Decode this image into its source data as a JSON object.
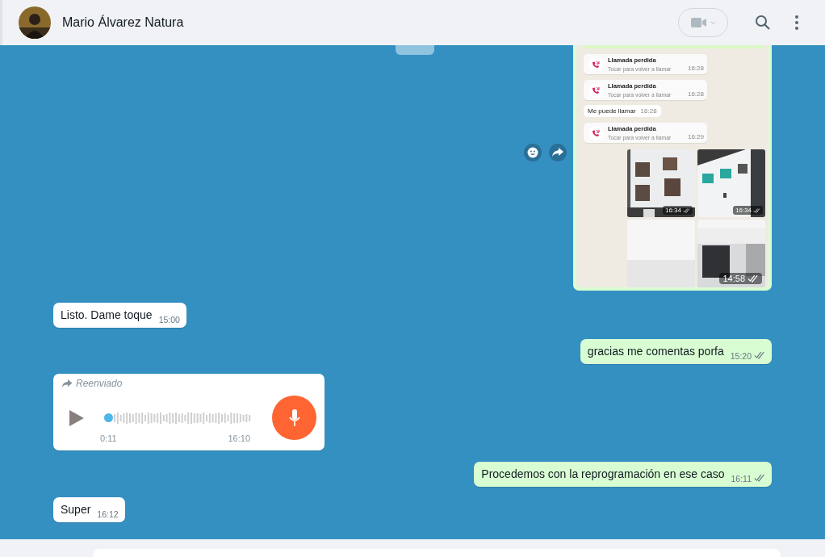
{
  "header": {
    "contact_name": "Mario Álvarez Natura"
  },
  "messages": [
    {
      "kind": "screenshot",
      "sent": true,
      "time": "14:58",
      "inner": [
        {
          "kind": "call",
          "title": "Llamada perdida",
          "subtitle": "Tocar para volver a llamar",
          "time": "16:28"
        },
        {
          "kind": "call",
          "title": "Llamada perdida",
          "subtitle": "Tocar para volver a llamar",
          "time": "16:28"
        },
        {
          "kind": "text",
          "text": "Me puede llamar",
          "time": "16:28"
        },
        {
          "kind": "call",
          "title": "Llamada perdida",
          "subtitle": "Tocar para volver a llamar",
          "time": "16:29"
        },
        {
          "kind": "photos",
          "times": [
            "16:34",
            "16:34"
          ]
        }
      ]
    },
    {
      "kind": "text",
      "sent": false,
      "text": "Listo. Dame toque",
      "time": "15:00"
    },
    {
      "kind": "text",
      "sent": true,
      "text": "gracias me comentas porfa",
      "time": "15:20"
    },
    {
      "kind": "voice",
      "sent": false,
      "forwarded_label": "Reenviado",
      "duration": "0:11",
      "time": "16:10",
      "level": 0
    },
    {
      "kind": "text",
      "sent": true,
      "text": "Procedemos con la reprogramación en ese caso",
      "time": "16:11"
    },
    {
      "kind": "text",
      "sent": false,
      "text": "Super",
      "time": "16:12"
    }
  ]
}
